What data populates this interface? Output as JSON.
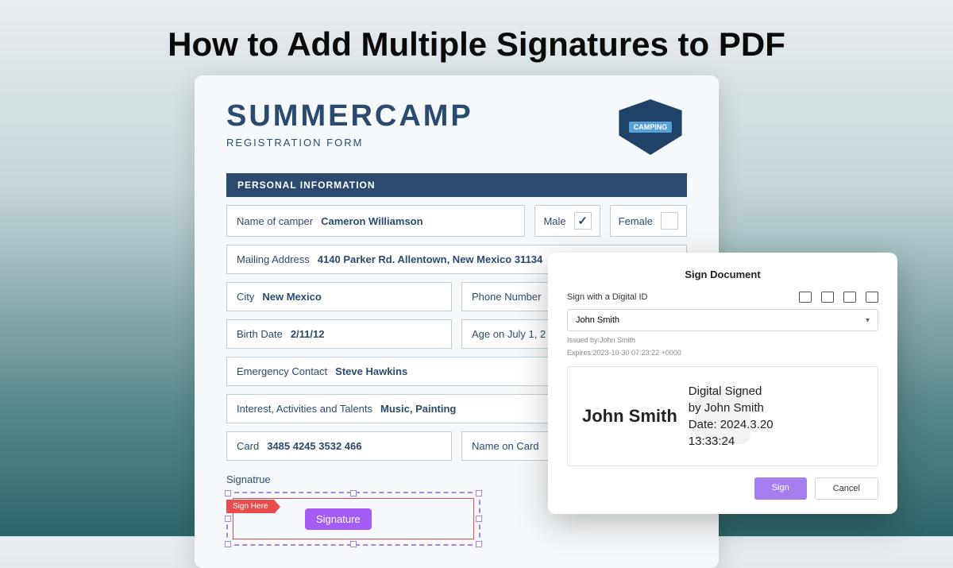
{
  "page_title": "How to Add Multiple Signatures to PDF",
  "form": {
    "brand": "SUMMERCAMP",
    "subtitle": "REGISTRATION FORM",
    "logo_label": "CAMPING",
    "section_header": "PERSONAL INFORMATION",
    "fields": {
      "name_label": "Name of camper",
      "name_value": "Cameron Williamson",
      "male_label": "Male",
      "female_label": "Female",
      "mailing_label": "Mailing Address",
      "mailing_value": "4140 Parker Rd. Allentown, New Mexico 31134",
      "city_label": "City",
      "city_value": "New Mexico",
      "phone_label": "Phone Number",
      "birth_label": "Birth Date",
      "birth_value": "2/11/12",
      "age_label": "Age on July 1, 2",
      "emerg_label": "Emergency Contact",
      "emerg_value": "Steve Hawkins",
      "interest_label": "Interest, Activities and Talents",
      "interest_value": "Music, Painting",
      "card_label": "Card",
      "card_value": "3485 4245 3532 466",
      "namecard_label": "Name on Card"
    },
    "signature": {
      "label": "Signatrue",
      "tag": "Sign Here",
      "pill": "Signature"
    }
  },
  "dialog": {
    "title": "Sign Document",
    "sub": "Sign with a Digital ID",
    "selected_id": "John Smith",
    "issued": "Issued by:John Smith",
    "expires": "Expires:2023-10-30 07:23:22 +0000",
    "preview_name": "John Smith",
    "preview_line1": "Digital Signed",
    "preview_line2": "by John Smith",
    "preview_line3": "Date: 2024.3.20",
    "preview_line4": "13:33:24",
    "sign": "Sign",
    "cancel": "Cancel"
  }
}
